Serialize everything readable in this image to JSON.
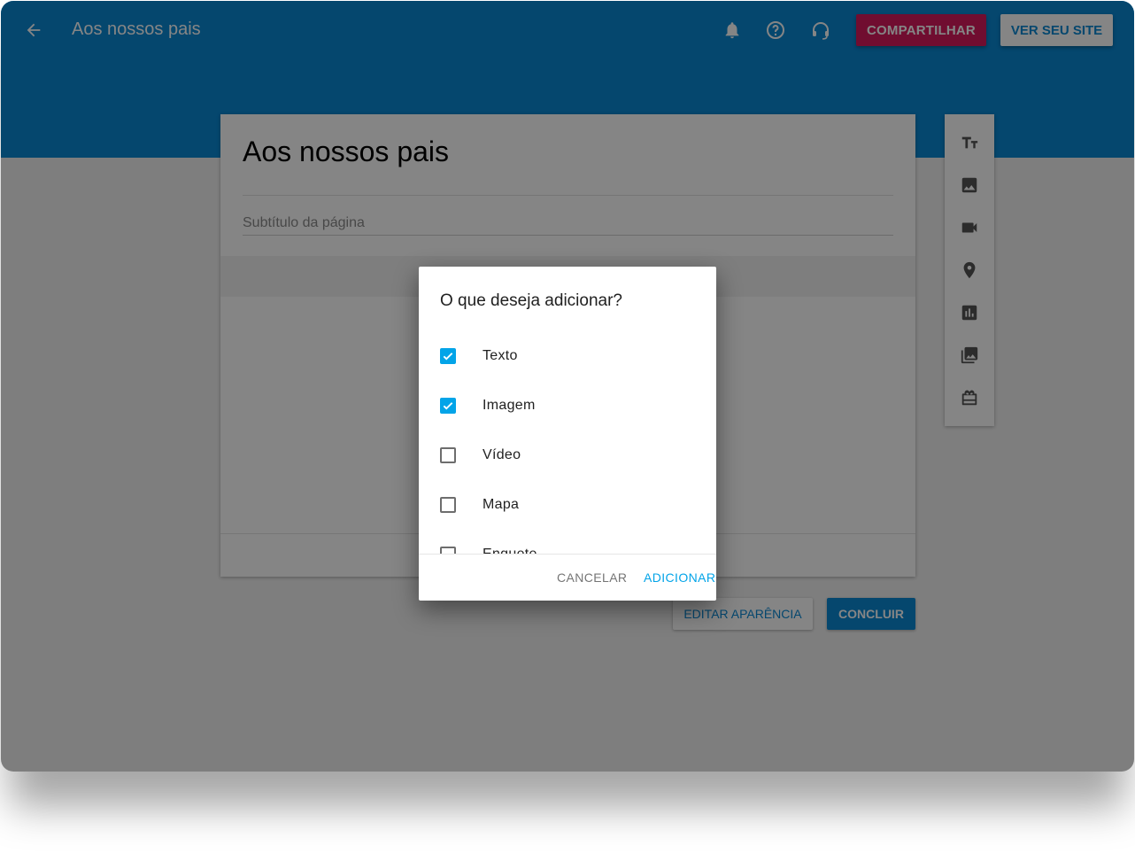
{
  "header": {
    "title": "Aos nossos pais",
    "share_label": "COMPARTILHAR",
    "view_site_label": "VER SEU SITE",
    "icons": [
      "arrow-back-icon",
      "bell-icon",
      "help-icon",
      "support-headset-icon"
    ]
  },
  "page": {
    "heading": "Aos nossos pais",
    "subtitle_placeholder": "Subtítulo da página"
  },
  "toolbar": {
    "tools": [
      "text-format-icon",
      "image-icon",
      "video-icon",
      "map-pin-icon",
      "poll-chart-icon",
      "gallery-icon",
      "gift-icon"
    ]
  },
  "actions": {
    "edit_appearance_label": "EDITAR APARÊNCIA",
    "done_label": "CONCLUIR"
  },
  "dialog": {
    "title": "O que deseja adicionar?",
    "options": [
      {
        "label": "Texto",
        "checked": true
      },
      {
        "label": "Imagem",
        "checked": true
      },
      {
        "label": "Vídeo",
        "checked": false
      },
      {
        "label": "Mapa",
        "checked": false
      },
      {
        "label": "Enquete",
        "checked": false
      }
    ],
    "cancel_label": "CANCELAR",
    "add_label": "ADICIONAR"
  },
  "colors": {
    "primary": "#0a88d4",
    "accent_share": "#d6195c",
    "checkbox": "#03a4e8"
  }
}
